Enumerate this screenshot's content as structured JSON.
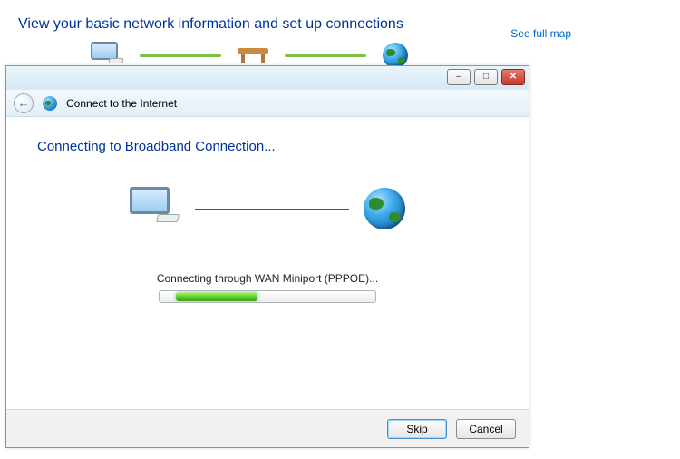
{
  "nsc": {
    "title": "View your basic network information and set up connections",
    "see_full_map": "See full map"
  },
  "wizard": {
    "window_title": "Connect to the Internet",
    "heading": "Connecting to Broadband Connection...",
    "status": "Connecting through WAN Miniport (PPPOE)...",
    "buttons": {
      "skip": "Skip",
      "cancel": "Cancel"
    }
  },
  "icons": {
    "back_arrow": "←",
    "minimize": "–",
    "maximize": "□",
    "close": "✕"
  }
}
